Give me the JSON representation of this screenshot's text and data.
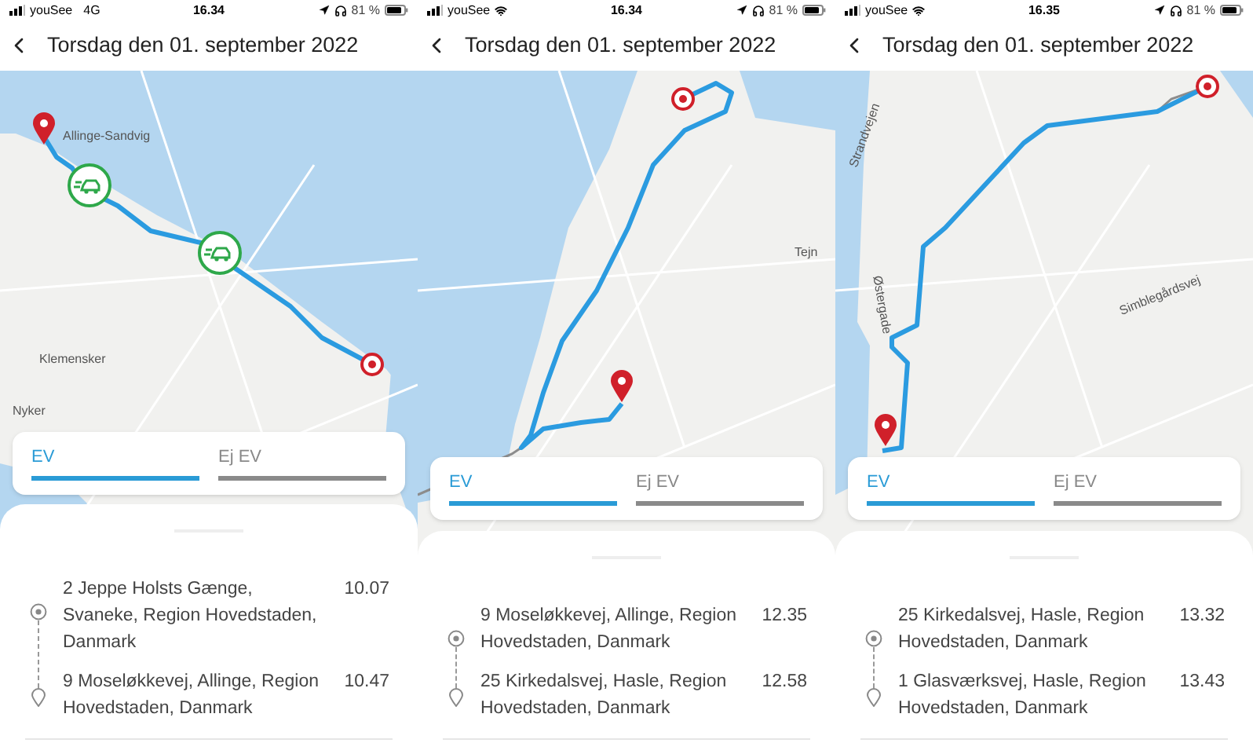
{
  "panels": [
    {
      "status": {
        "carrier": "youSee",
        "connection": {
          "kind": "text",
          "label": "4G"
        },
        "time": "16.34",
        "battery": "81 %"
      },
      "title": "Torsdag den 01. september 2022",
      "map_labels": [
        "Allinge-Sandvig",
        "Klemensker",
        "Nyker"
      ],
      "tabs": [
        {
          "label": "EV",
          "selected": true
        },
        {
          "label": "Ej EV",
          "selected": false
        }
      ],
      "stops": [
        {
          "address": "2 Jeppe Holsts Gænge, Svaneke, Region Hovedstaden, Danmark",
          "time": "10.07"
        },
        {
          "address": "9 Moseløkkevej, Allinge, Region Hovedstaden, Danmark",
          "time": "10.47"
        }
      ]
    },
    {
      "status": {
        "carrier": "youSee",
        "connection": {
          "kind": "wifi"
        },
        "time": "16.34",
        "battery": "81 %"
      },
      "title": "Torsdag den 01. september 2022",
      "map_labels": [
        "Tejn"
      ],
      "tabs": [
        {
          "label": "EV",
          "selected": true
        },
        {
          "label": "Ej EV",
          "selected": false
        }
      ],
      "stops": [
        {
          "address": "9 Moseløkkevej, Allinge, Region Hovedstaden, Danmark",
          "time": "12.35"
        },
        {
          "address": "25 Kirkedalsvej, Hasle, Region Hovedstaden, Danmark",
          "time": "12.58"
        }
      ]
    },
    {
      "status": {
        "carrier": "youSee",
        "connection": {
          "kind": "wifi"
        },
        "time": "16.35",
        "battery": "81 %"
      },
      "title": "Torsdag den 01. september 2022",
      "map_labels": [
        "Strandvejen",
        "Østergade",
        "Simblegårdsvej"
      ],
      "tabs": [
        {
          "label": "EV",
          "selected": true
        },
        {
          "label": "Ej EV",
          "selected": false
        }
      ],
      "stops": [
        {
          "address": "25 Kirkedalsvej, Hasle, Region Hovedstaden, Danmark",
          "time": "13.32"
        },
        {
          "address": "1 Glasværksvej, Hasle, Region Hovedstaden, Danmark",
          "time": "13.43"
        }
      ]
    }
  ]
}
